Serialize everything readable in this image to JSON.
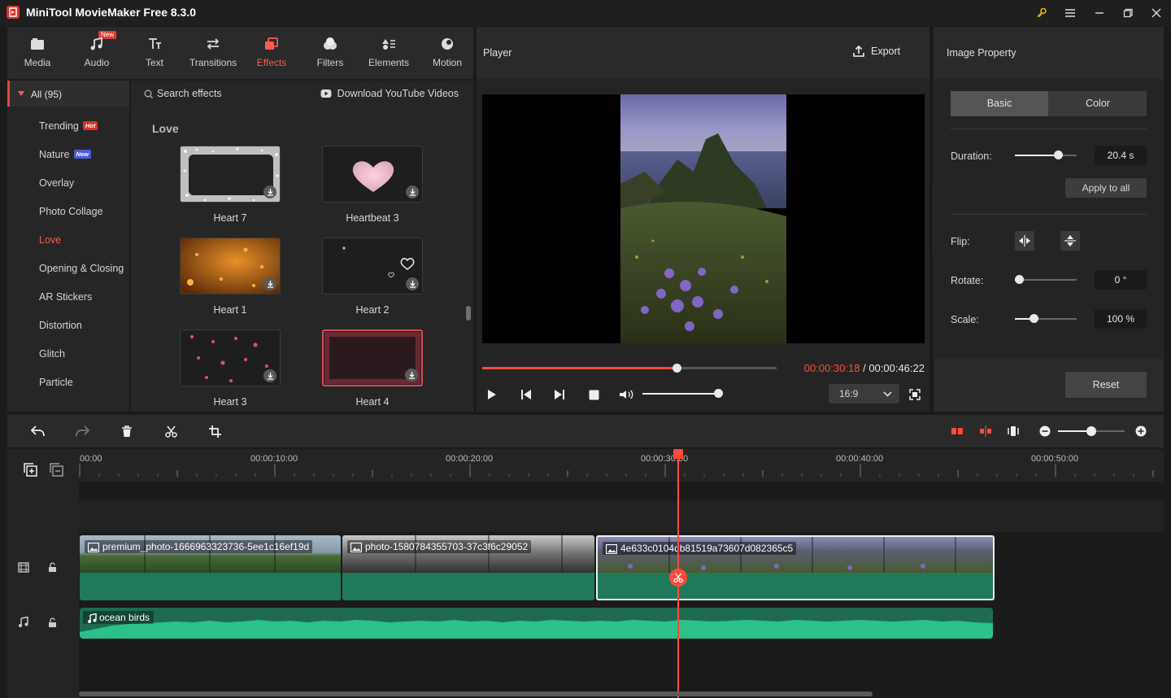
{
  "app": {
    "title": "MiniTool MovieMaker Free 8.3.0"
  },
  "tool_tabs": [
    {
      "label": "Media",
      "icon": "media-icon"
    },
    {
      "label": "Audio",
      "icon": "music-note-icon",
      "badge": "New"
    },
    {
      "label": "Text",
      "icon": "text-icon"
    },
    {
      "label": "Transitions",
      "icon": "transitions-icon"
    },
    {
      "label": "Effects",
      "icon": "effects-icon",
      "active": true
    },
    {
      "label": "Filters",
      "icon": "filters-icon"
    },
    {
      "label": "Elements",
      "icon": "elements-icon"
    },
    {
      "label": "Motion",
      "icon": "motion-icon"
    }
  ],
  "categories": {
    "all_label": "All (95)",
    "items": [
      {
        "label": "Trending",
        "badge": "Hot"
      },
      {
        "label": "Nature",
        "badge": "New"
      },
      {
        "label": "Overlay"
      },
      {
        "label": "Photo Collage"
      },
      {
        "label": "Love",
        "active": true
      },
      {
        "label": "Opening & Closing"
      },
      {
        "label": "AR Stickers"
      },
      {
        "label": "Distortion"
      },
      {
        "label": "Glitch"
      },
      {
        "label": "Particle"
      }
    ]
  },
  "library": {
    "search_label": "Search effects",
    "download_label": "Download YouTube Videos",
    "section_title": "Love",
    "items": [
      {
        "label": "Heart 7"
      },
      {
        "label": "Heartbeat 3"
      },
      {
        "label": "Heart 1"
      },
      {
        "label": "Heart 2"
      },
      {
        "label": "Heart 3"
      },
      {
        "label": "Heart 4"
      }
    ]
  },
  "player": {
    "title": "Player",
    "export_label": "Export",
    "progress": 0.66,
    "time_current": "00:00:30:18",
    "time_separator": " / ",
    "time_total": "00:00:46:22",
    "volume": 1.0,
    "aspect_ratio": "16:9"
  },
  "properties": {
    "title": "Image Property",
    "tabs": [
      "Basic",
      "Color"
    ],
    "duration_label": "Duration:",
    "duration_value": "20.4 s",
    "duration_level": 0.7,
    "apply_all_label": "Apply to all",
    "flip_label": "Flip:",
    "rotate_label": "Rotate:",
    "rotate_value": "0 °",
    "rotate_level": 0.07,
    "scale_label": "Scale:",
    "scale_value": "100 %",
    "scale_level": 0.3,
    "reset_label": "Reset"
  },
  "timeline": {
    "ruler_labels": [
      "00:00",
      "00:00:10:00",
      "00:00:20:00",
      "00:00:30:00",
      "00:00:40:00",
      "00:00:50:00"
    ],
    "zoom_level": 0.5,
    "clips": [
      {
        "name": "premium_photo-1666963323736-5ee1c16ef19d"
      },
      {
        "name": "photo-1580784355703-37c3f6c29052"
      },
      {
        "name": "4e633c0104db81519a73607d082365c5"
      }
    ],
    "audio_clip": {
      "name": "ocean birds"
    }
  },
  "colors": {
    "accent": "#ff4a3d",
    "clip_green": "#1f7a5a",
    "audio_green": "#2cc08a"
  }
}
